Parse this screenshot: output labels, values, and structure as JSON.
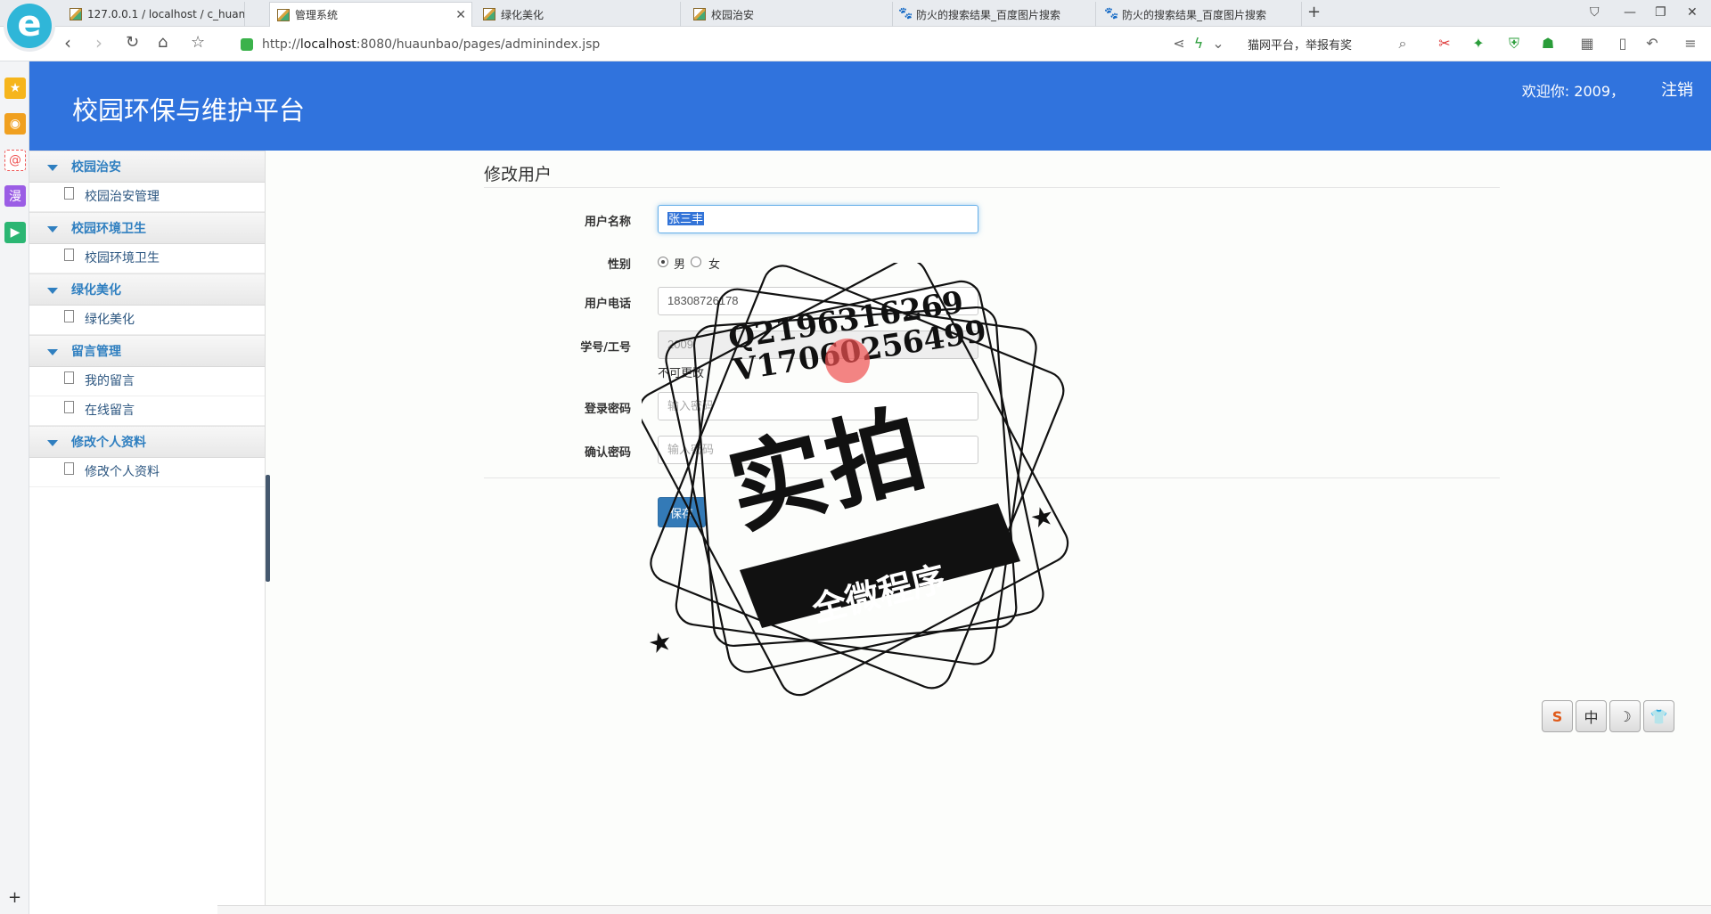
{
  "browser": {
    "logo_letter": "e",
    "tabs": [
      {
        "title": "127.0.0.1 / localhost / c_huanb",
        "favicon": "phpmyadmin-icon"
      },
      {
        "title": "管理系统",
        "favicon": "page-chart-icon"
      },
      {
        "title": "绿化美化",
        "favicon": "page-chart-icon"
      },
      {
        "title": "校园治安",
        "favicon": "page-chart-icon"
      },
      {
        "title": "防火的搜索结果_百度图片搜索",
        "favicon": "baidu-paw-icon"
      },
      {
        "title": "防火的搜索结果_百度图片搜索",
        "favicon": "baidu-paw-icon"
      }
    ],
    "new_tab": "+",
    "url_prefix": "http://",
    "url_host": "localhost",
    "url_rest": ":8080/huaunbao/pages/adminindex.jsp",
    "search_hint": "猫网平台，举报有奖",
    "accent_color": "#3073dd"
  },
  "app": {
    "title": "校园环保与维护平台",
    "welcome": "欢迎你: 2009，",
    "logout": "注销"
  },
  "sidebar": {
    "groups": [
      {
        "title": "校园治安",
        "items": [
          "校园治安管理"
        ]
      },
      {
        "title": "校园环境卫生",
        "items": [
          "校园环境卫生"
        ]
      },
      {
        "title": "绿化美化",
        "items": [
          "绿化美化"
        ]
      },
      {
        "title": "留言管理",
        "items": [
          "我的留言",
          "在线留言"
        ]
      },
      {
        "title": "修改个人资料",
        "items": [
          "修改个人资料"
        ]
      }
    ]
  },
  "form": {
    "title": "修改用户",
    "username_label": "用户名称",
    "username_value": "张三丰",
    "gender_label": "性别",
    "gender_male": "男",
    "gender_female": "女",
    "gender_selected": "男",
    "phone_label": "用户电话",
    "phone_value": "18308726178",
    "id_label": "学号/工号",
    "id_value": "2009",
    "id_hint": "不可更改",
    "password_label": "登录密码",
    "password_placeholder": "输入密码",
    "confirm_label": "确认密码",
    "confirm_placeholder": "输入密码",
    "save_label": "保存"
  },
  "watermark": {
    "line1": "Q2196316269",
    "line2": "V17060256499",
    "main": "实拍",
    "sub": "全微程序"
  },
  "ime": {
    "keys": [
      "S",
      "中",
      "☽",
      "👕"
    ]
  }
}
